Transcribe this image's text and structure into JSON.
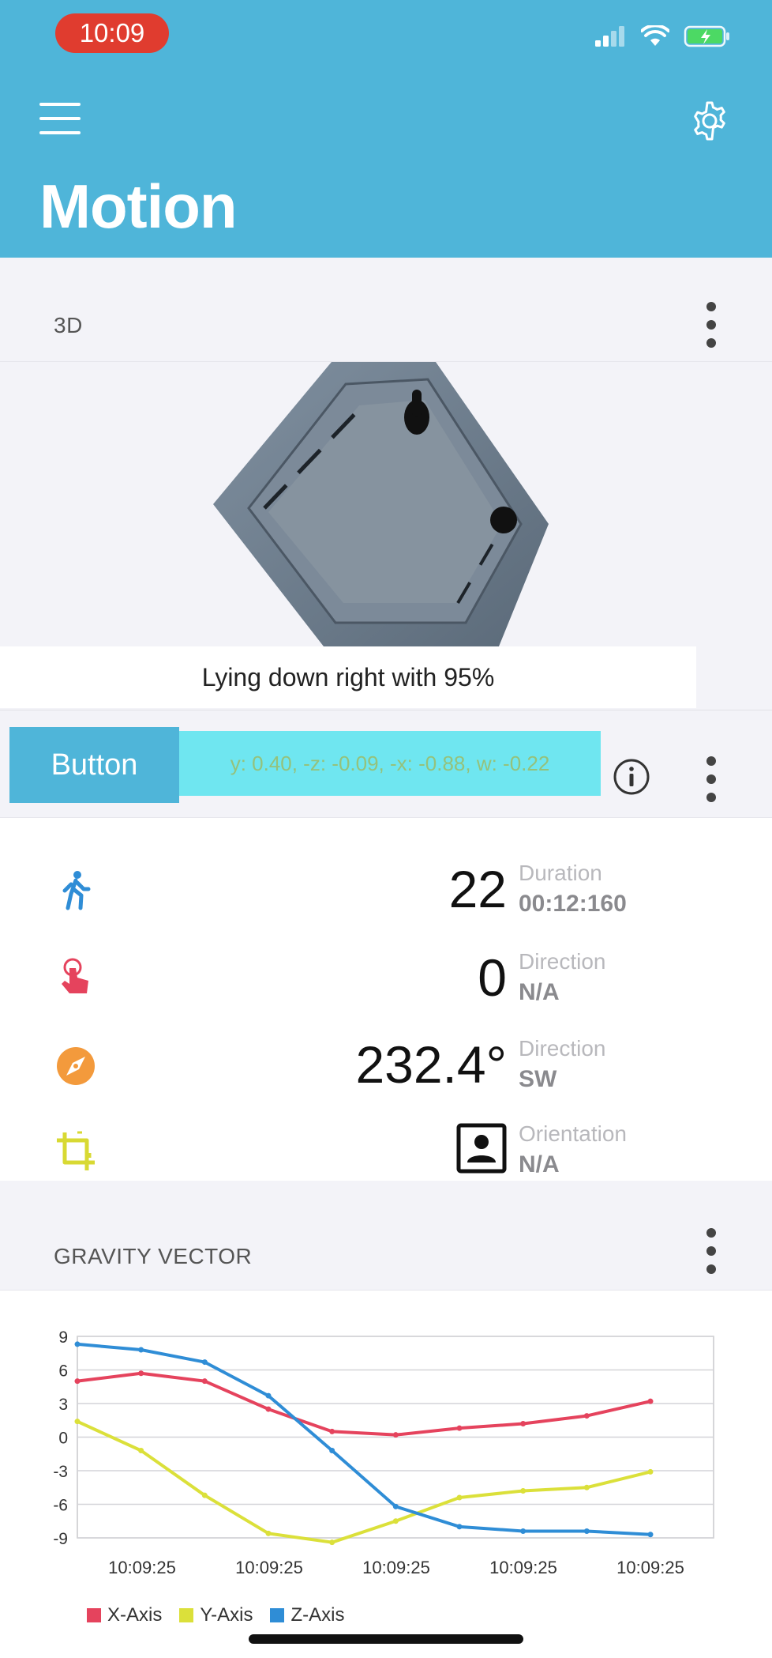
{
  "status_bar": {
    "time": "10:09"
  },
  "header": {
    "title": "Motion"
  },
  "section_3d": {
    "title": "3D",
    "caption": "Lying down right with 95%"
  },
  "button_row": {
    "button_label": "Button",
    "quaternion_text": "y: 0.40, -z: -0.09, -x: -0.88, w: -0.22"
  },
  "stats": [
    {
      "icon": "walking-person-icon",
      "value": "22",
      "label": "Duration",
      "sub": "00:12:160",
      "color": "#2f8dd6"
    },
    {
      "icon": "tap-hand-icon",
      "value": "0",
      "label": "Direction",
      "sub": "N/A",
      "color": "#e5435d"
    },
    {
      "icon": "compass-icon",
      "value": "232.4°",
      "label": "Direction",
      "sub": "SW",
      "color": "#f39a3c"
    },
    {
      "icon": "crop-rotate-icon",
      "value": "",
      "label": "Orientation",
      "sub": "N/A",
      "color": "#d8d933"
    }
  ],
  "gravity": {
    "title": "GRAVITY VECTOR"
  },
  "colors": {
    "accent": "#4fb5d9",
    "x_axis": "#e5435d",
    "y_axis": "#dbe03a",
    "z_axis": "#2f8dd6"
  },
  "chart_data": {
    "type": "line",
    "x": [
      "10:09:25",
      "10:09:25",
      "10:09:25",
      "10:09:25",
      "10:09:25",
      "10:09:25",
      "10:09:25",
      "10:09:25",
      "10:09:25",
      "10:09:25"
    ],
    "x_tick_labels": [
      "10:09:25",
      "10:09:25",
      "10:09:25",
      "10:09:25",
      "10:09:25"
    ],
    "y_ticks": [
      9,
      6,
      3,
      0,
      -3,
      -6,
      -9
    ],
    "ylim": [
      -9,
      9
    ],
    "series": [
      {
        "name": "X-Axis",
        "color": "#e5435d",
        "values": [
          5.0,
          5.7,
          5.0,
          2.5,
          0.5,
          0.2,
          0.8,
          1.2,
          1.9,
          3.2
        ]
      },
      {
        "name": "Y-Axis",
        "color": "#dbe03a",
        "values": [
          1.4,
          -1.2,
          -5.2,
          -8.6,
          -9.4,
          -7.5,
          -5.4,
          -4.8,
          -4.5,
          -3.1
        ]
      },
      {
        "name": "Z-Axis",
        "color": "#2f8dd6",
        "values": [
          8.3,
          7.8,
          6.7,
          3.7,
          -1.2,
          -6.2,
          -8.0,
          -8.4,
          -8.4,
          -8.7
        ]
      }
    ],
    "grid": true,
    "legend": "bottom-left"
  }
}
